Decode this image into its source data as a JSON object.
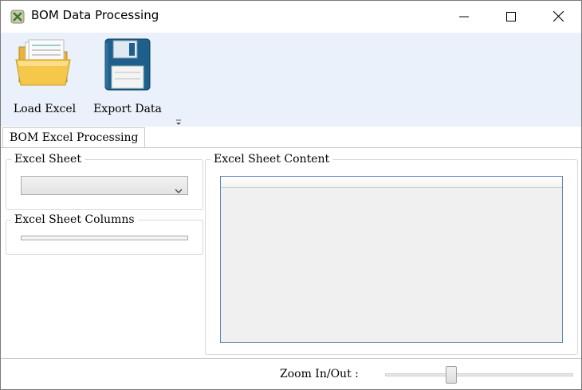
{
  "window": {
    "title": "BOM Data Processing",
    "icons": {
      "app": "app-icon",
      "minimize": "minimize-icon",
      "maximize": "maximize-icon",
      "close": "close-icon"
    }
  },
  "ribbon": {
    "buttons": [
      {
        "label": "Load Excel",
        "icon": "folder-icon"
      },
      {
        "label": "Export Data",
        "icon": "floppy-disk-icon"
      }
    ]
  },
  "tabs": [
    {
      "label": "BOM Excel Processing",
      "selected": true
    }
  ],
  "panels": {
    "excel_sheet": {
      "title": "Excel Sheet",
      "selected_value": ""
    },
    "excel_sheet_columns": {
      "title": "Excel Sheet Columns"
    },
    "excel_sheet_content": {
      "title": "Excel Sheet Content"
    }
  },
  "status": {
    "zoom_label": "Zoom In/Out :",
    "zoom_level": 0.35
  },
  "colors": {
    "ribbon_bg": "#eaf1fb",
    "grid_border": "#5b84b8",
    "folder_yellow": "#f5c84b",
    "floppy_blue": "#1f5f8b"
  }
}
